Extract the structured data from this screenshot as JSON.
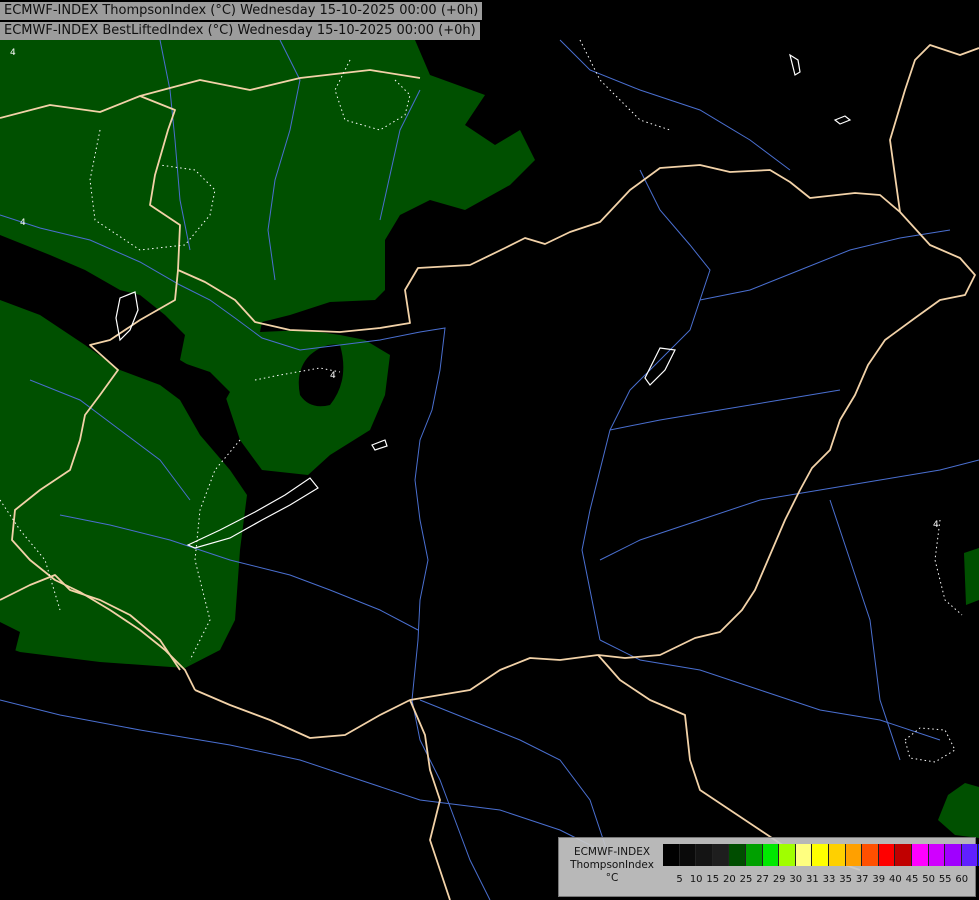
{
  "titles": {
    "line1": "ECMWF-INDEX ThompsonIndex (°C) Wednesday 15-10-2025 00:00 (+0h)",
    "line2": "ECMWF-INDEX BestLiftedIndex (°C) Wednesday 15-10-2025 00:00 (+0h)"
  },
  "legend": {
    "model": "ECMWF-INDEX",
    "parameter": "ThompsonIndex",
    "unit": "°C",
    "colors": [
      "#000000",
      "#0a0a0a",
      "#141414",
      "#1e1e1e",
      "#004d00",
      "#00a000",
      "#00e800",
      "#a0ff00",
      "#ffff80",
      "#ffff00",
      "#ffd000",
      "#ffa000",
      "#ff5000",
      "#ff0000",
      "#c00000",
      "#ff00ff",
      "#d000ff",
      "#a000ff",
      "#6020ff",
      "#0000ff"
    ],
    "ticks": [
      "5",
      "10",
      "15",
      "20",
      "25",
      "27",
      "29",
      "30",
      "31",
      "33",
      "35",
      "37",
      "39",
      "40",
      "45",
      "50",
      "55",
      "60"
    ]
  },
  "map_colors": {
    "background": "#000000",
    "thompson_fill": "#005000",
    "borders": "#f2d2a8",
    "rivers": "#4a6fd0",
    "isolines": "#ffffff"
  }
}
